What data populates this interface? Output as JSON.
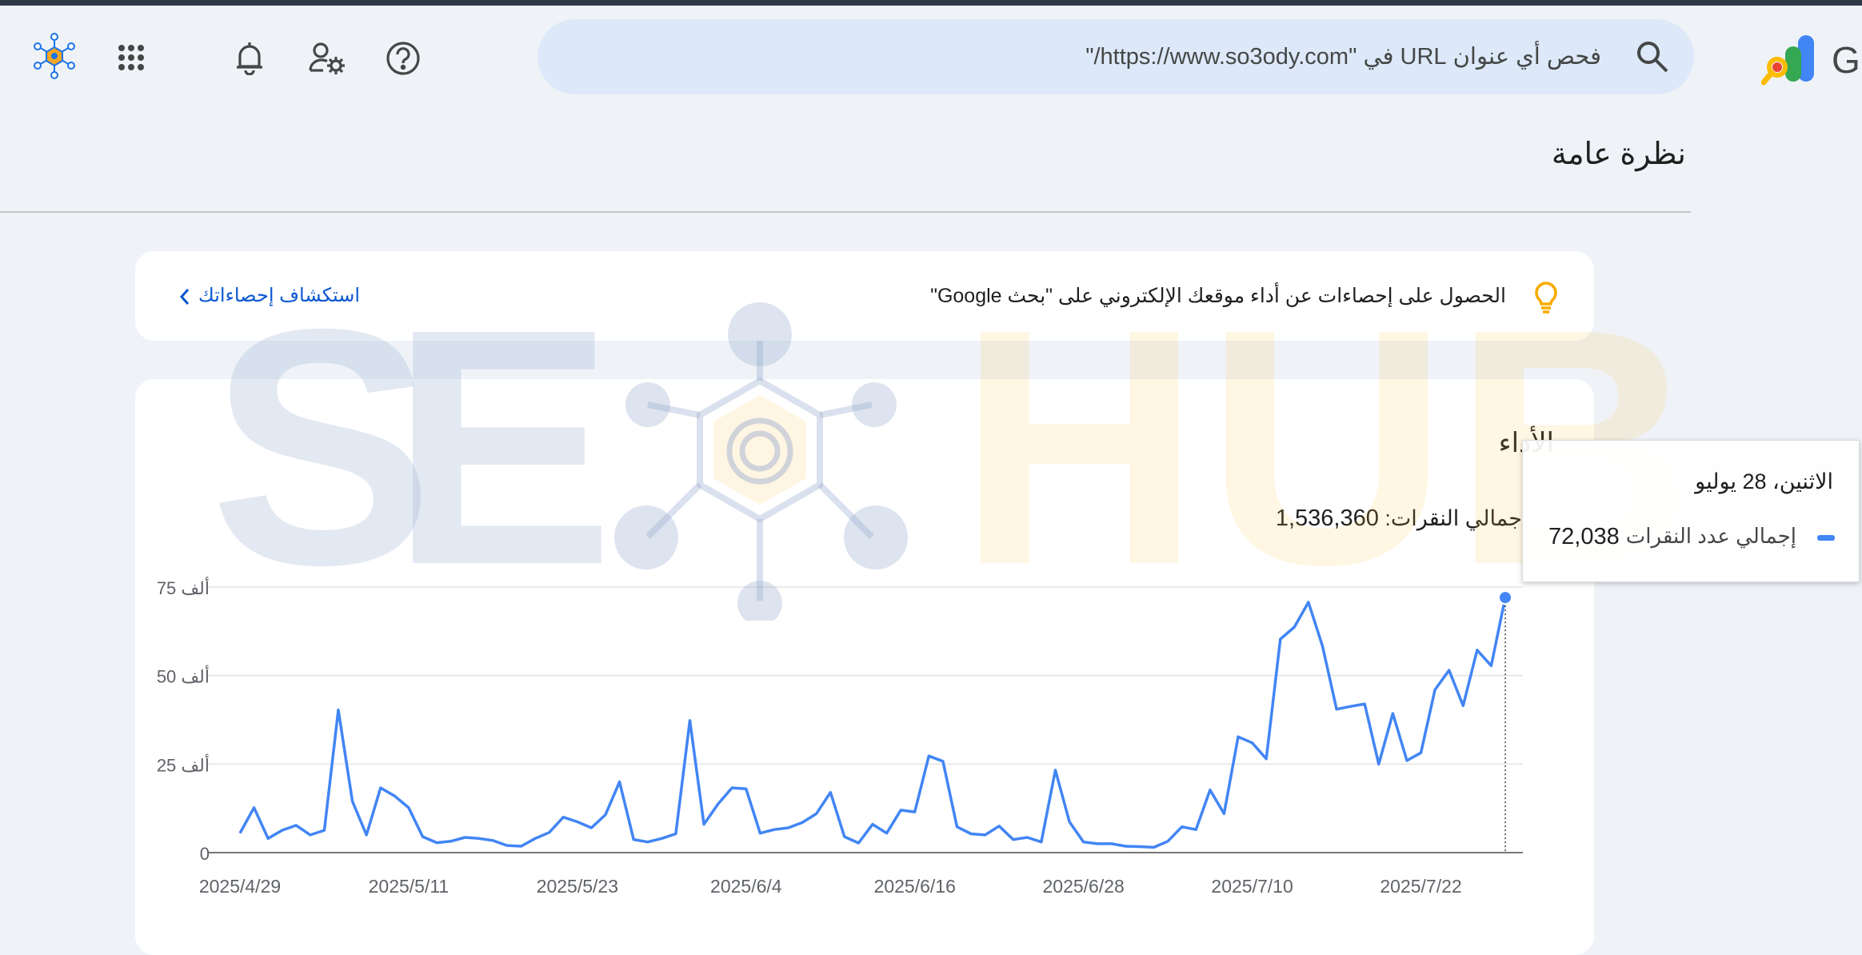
{
  "header": {
    "search_placeholder": "فحص أي عنوان URL في \"https://www.so3ody.com/\"",
    "brand_letter": "G"
  },
  "page": {
    "title": "نظرة عامة"
  },
  "insights": {
    "text": "الحصول على إحصاءات عن أداء موقعك الإلكتروني على \"بحث Google\"",
    "link_label": "استكشاف إحصاءاتك"
  },
  "performance": {
    "title": "الأداء",
    "total_label": "جمالي النقرات:",
    "total_value": "1,536,360"
  },
  "tooltip": {
    "date": "الاثنين، 28 يوليو",
    "series_label": "إجمالي عدد النقرات",
    "value": "72,038"
  },
  "watermark": {
    "text_s": "S",
    "text_e": "E",
    "text_hub": "HUB"
  },
  "colors": {
    "line": "#4285f4",
    "accent": "#0b57d0",
    "bulb": "#f9ab00",
    "background": "#eff3f8"
  },
  "chart_data": {
    "type": "line",
    "x_tick_labels": [
      "2025/4/29",
      "2025/5/11",
      "2025/5/23",
      "2025/6/4",
      "2025/6/16",
      "2025/6/28",
      "2025/7/10",
      "2025/7/22"
    ],
    "y_tick_labels": [
      "0",
      "25 ألف",
      "50 ألف",
      "75 ألف"
    ],
    "ylim": [
      0,
      75000
    ],
    "grid": true,
    "legend": "none",
    "series": [
      {
        "name": "إجمالي عدد النقرات",
        "x_start": "2025/4/29",
        "x_end": "2025/7/28",
        "values": [
          5500,
          12700,
          4000,
          6300,
          7700,
          5000,
          6300,
          40300,
          14500,
          5000,
          18300,
          16000,
          12700,
          4500,
          2800,
          3200,
          4300,
          4000,
          3400,
          2000,
          1800,
          4000,
          5700,
          10000,
          8700,
          7000,
          10700,
          20000,
          3700,
          3000,
          4000,
          5300,
          37300,
          8000,
          13700,
          18300,
          18000,
          5500,
          6500,
          7000,
          8500,
          11000,
          17000,
          4500,
          2700,
          8000,
          5500,
          12000,
          11500,
          27300,
          25800,
          7300,
          5300,
          5000,
          7500,
          3700,
          4300,
          3000,
          23300,
          8700,
          3000,
          2500,
          2500,
          1800,
          1700,
          1500,
          3200,
          7300,
          6500,
          17700,
          11000,
          32700,
          31000,
          26500,
          60300,
          63700,
          70700,
          58300,
          40500,
          41300,
          42000,
          25000,
          39300,
          26000,
          28200,
          46000,
          51500,
          41500,
          57200,
          52800,
          72038
        ]
      }
    ],
    "highlight": {
      "x": "2025/7/28",
      "y": 72038
    }
  }
}
